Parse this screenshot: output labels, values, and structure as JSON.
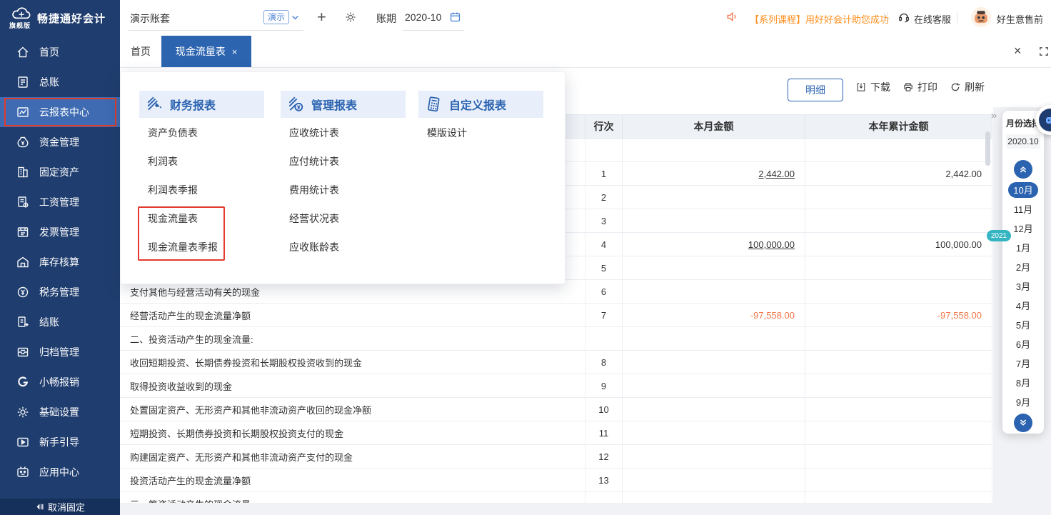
{
  "brand": {
    "name": "畅捷通好会计",
    "edition": "旗舰版"
  },
  "sidebar": {
    "items": [
      {
        "key": "home",
        "icon": "home-icon",
        "label": "首页"
      },
      {
        "key": "general-ledger",
        "icon": "ledger-icon",
        "label": "总账"
      },
      {
        "key": "cloud-report-center",
        "icon": "report-center-icon",
        "label": "云报表中心",
        "active": true,
        "annotated": true
      },
      {
        "key": "funds",
        "icon": "funds-icon",
        "label": "资金管理"
      },
      {
        "key": "fixed-assets",
        "icon": "fixed-assets-icon",
        "label": "固定资产"
      },
      {
        "key": "salary",
        "icon": "salary-icon",
        "label": "工资管理"
      },
      {
        "key": "invoice",
        "icon": "invoice-icon",
        "label": "发票管理"
      },
      {
        "key": "inventory",
        "icon": "inventory-icon",
        "label": "库存核算"
      },
      {
        "key": "tax",
        "icon": "tax-icon",
        "label": "税务管理"
      },
      {
        "key": "closing",
        "icon": "closing-icon",
        "label": "结账"
      },
      {
        "key": "archive",
        "icon": "archive-icon",
        "label": "归档管理"
      },
      {
        "key": "reimburse",
        "icon": "reimburse-icon",
        "label": "小畅报销"
      },
      {
        "key": "settings",
        "icon": "settings-icon",
        "label": "基础设置"
      },
      {
        "key": "guide",
        "icon": "guide-icon",
        "label": "新手引导"
      },
      {
        "key": "app-center",
        "icon": "app-center-icon",
        "label": "应用中心"
      }
    ],
    "unpin_label": "取消固定"
  },
  "topbar": {
    "account_set": "演示账套",
    "demo_badge": "演示",
    "plus": "+",
    "period_label": "账期",
    "period_value": "2020-10",
    "announcement": "【系列课程】用好好会计助您成功",
    "online_service": "在线客服",
    "user_name": "好生意售前"
  },
  "tabs": {
    "home_label": "首页",
    "active_label": "现金流量表",
    "close_symbol": "×"
  },
  "window_controls": {
    "close_all": "×",
    "collapse": "»"
  },
  "report_menu": {
    "columns": [
      {
        "title": "财务报表",
        "icon": "finance-report-icon",
        "items": [
          {
            "key": "balance-sheet",
            "label": "资产负债表"
          },
          {
            "key": "income-statement",
            "label": "利润表"
          },
          {
            "key": "income-statement-quarterly",
            "label": "利润表季报"
          },
          {
            "key": "cash-flow",
            "label": "现金流量表",
            "annotated": true
          },
          {
            "key": "cash-flow-quarterly",
            "label": "现金流量表季报",
            "annotated": true
          }
        ]
      },
      {
        "title": "管理报表",
        "icon": "management-report-icon",
        "items": [
          {
            "key": "receivable-stats",
            "label": "应收统计表"
          },
          {
            "key": "payable-stats",
            "label": "应付统计表"
          },
          {
            "key": "expense-stats",
            "label": "费用统计表"
          },
          {
            "key": "operation-status",
            "label": "经营状况表"
          },
          {
            "key": "receivable-aging",
            "label": "应收账龄表"
          }
        ]
      },
      {
        "title": "自定义报表",
        "icon": "custom-report-icon",
        "items": [
          {
            "key": "template-design",
            "label": "模版设计"
          }
        ]
      }
    ]
  },
  "toolbar": {
    "detail": "明细",
    "download": "下载",
    "print": "打印",
    "refresh": "刷新"
  },
  "table": {
    "headers": {
      "item": "",
      "row_no": "行次",
      "month_amount": "本月金额",
      "ytd_amount": "本年累计金额"
    },
    "rows": [
      {
        "item": "",
        "row_no": "",
        "month": "",
        "ytd": ""
      },
      {
        "item": "",
        "row_no": "1",
        "month": "2,442.00",
        "ytd": "2,442.00",
        "month_link": true
      },
      {
        "item": "",
        "row_no": "2",
        "month": "",
        "ytd": ""
      },
      {
        "item": "",
        "row_no": "3",
        "month": "",
        "ytd": ""
      },
      {
        "item": "",
        "row_no": "4",
        "month": "100,000.00",
        "ytd": "100,000.00",
        "month_link": true
      },
      {
        "item": "",
        "row_no": "5",
        "month": "",
        "ytd": ""
      },
      {
        "item": "支付其他与经营活动有关的现金",
        "row_no": "6",
        "month": "",
        "ytd": ""
      },
      {
        "item": "经营活动产生的现金流量净额",
        "row_no": "7",
        "month": "-97,558.00",
        "ytd": "-97,558.00",
        "negative": true
      },
      {
        "item": "二、投资活动产生的现金流量:",
        "row_no": "",
        "month": "",
        "ytd": ""
      },
      {
        "item": "收回短期投资、长期债券投资和长期股权投资收到的现金",
        "row_no": "8",
        "month": "",
        "ytd": ""
      },
      {
        "item": "取得投资收益收到的现金",
        "row_no": "9",
        "month": "",
        "ytd": ""
      },
      {
        "item": "处置固定资产、无形资产和其他非流动资产收回的现金净额",
        "row_no": "10",
        "month": "",
        "ytd": ""
      },
      {
        "item": "短期投资、长期债券投资和长期股权投资支付的现金",
        "row_no": "11",
        "month": "",
        "ytd": ""
      },
      {
        "item": "购建固定资产、无形资产和其他非流动资产支付的现金",
        "row_no": "12",
        "month": "",
        "ytd": ""
      },
      {
        "item": "投资活动产生的现金流量净额",
        "row_no": "13",
        "month": "",
        "ytd": ""
      },
      {
        "item": "三、筹资活动产生的现金流量:",
        "row_no": "",
        "month": "",
        "ytd": ""
      }
    ]
  },
  "month_panel": {
    "title": "月份选择",
    "current": "2020.10",
    "year_badge": "2021",
    "selected_month": "10月",
    "months": [
      "10月",
      "11月",
      "12月",
      "1月",
      "2月",
      "3月",
      "4月",
      "5月",
      "6月",
      "7月",
      "8月",
      "9月"
    ]
  },
  "colors": {
    "sidebar_bg": "#1f3d6e",
    "primary_blue": "#2b63b0",
    "announcement_orange": "#ff8e1c",
    "negative_orange": "#f2764a",
    "annotation_red": "#e23b2c",
    "year_badge_teal": "#35b5c1"
  }
}
